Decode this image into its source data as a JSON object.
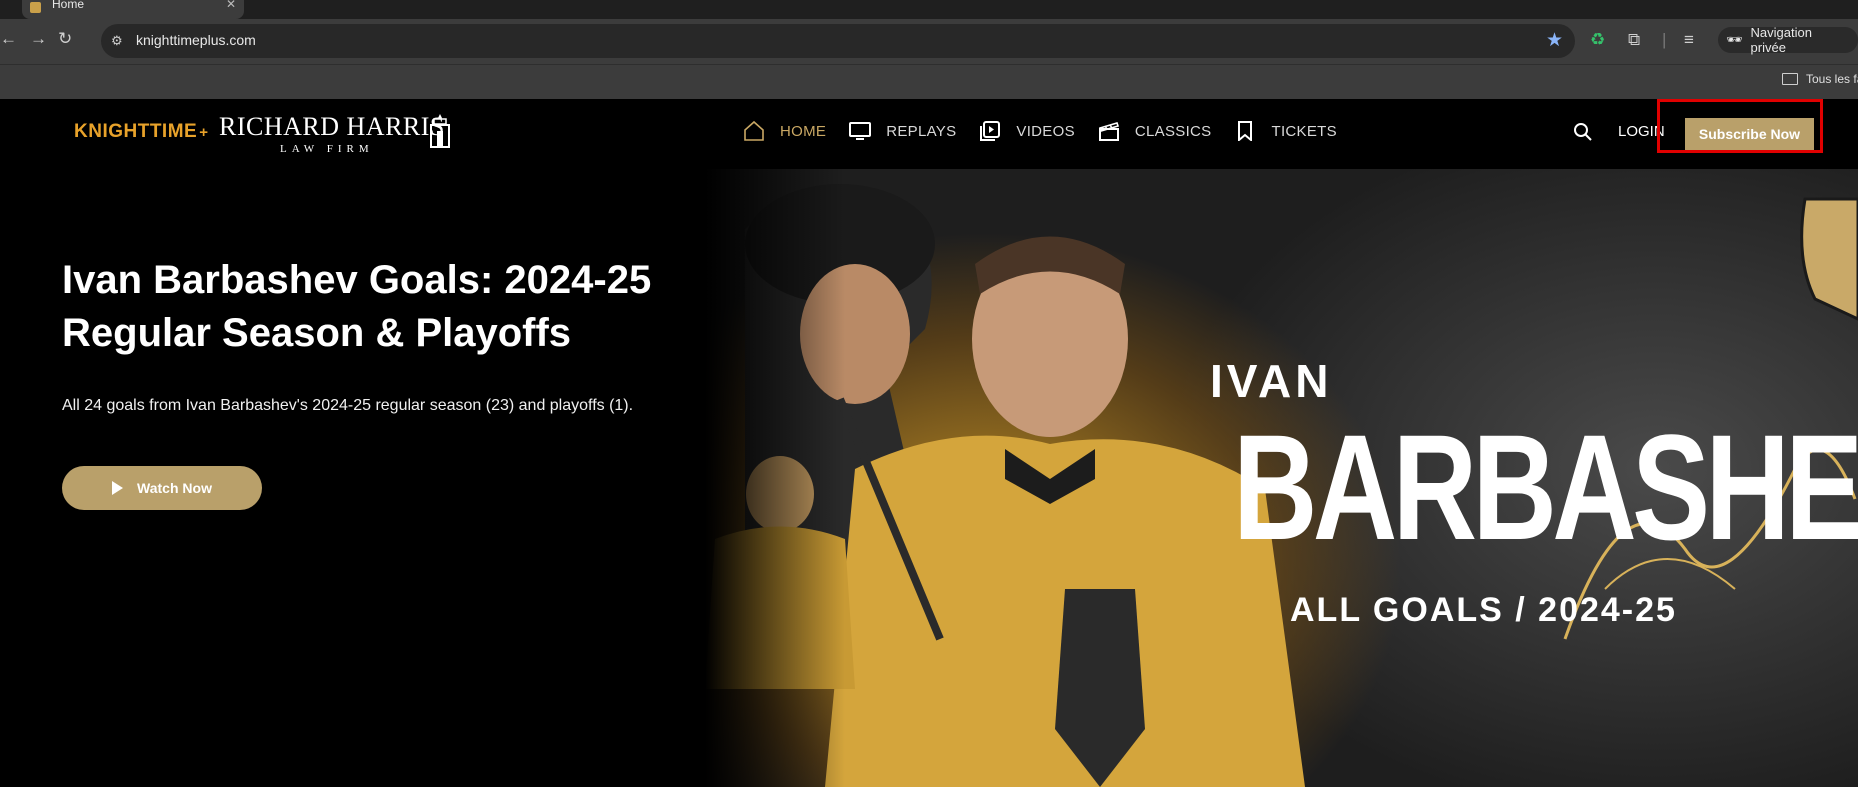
{
  "browser": {
    "tab_title": "Home",
    "url": "knighttimeplus.com",
    "private_label": "Navigation privée",
    "bookmark_folder": "Tous les fa"
  },
  "header": {
    "logo_brand": "KNIGHTTIME",
    "logo_plus": "+",
    "sponsor_name": "RICHARD HARRIS",
    "sponsor_sub": "LAW FIRM",
    "nav": [
      {
        "label": "HOME",
        "icon": "home-icon"
      },
      {
        "label": "REPLAYS",
        "icon": "monitor-icon"
      },
      {
        "label": "VIDEOS",
        "icon": "video-play-icon"
      },
      {
        "label": "CLASSICS",
        "icon": "clapperboard-icon"
      },
      {
        "label": "TICKETS",
        "icon": "bookmark-icon"
      }
    ],
    "login_label": "LOGIN",
    "subscribe_label": "Subscribe Now"
  },
  "hero": {
    "title": "Ivan Barbashev Goals: 2024-25 Regular Season & Playoffs",
    "description": "All 24 goals from Ivan Barbashev's 2024-25 regular season (23) and playoffs (1).",
    "watch_label": "Watch Now",
    "art_first": "IVAN",
    "art_last": "BARBASHEV",
    "art_sub": "ALL GOALS / 2024-25"
  },
  "colors": {
    "accent_gold": "#b9a06a",
    "active_nav": "#caa864",
    "brand_orange": "#e8a22a",
    "highlight_red": "#e10000"
  }
}
